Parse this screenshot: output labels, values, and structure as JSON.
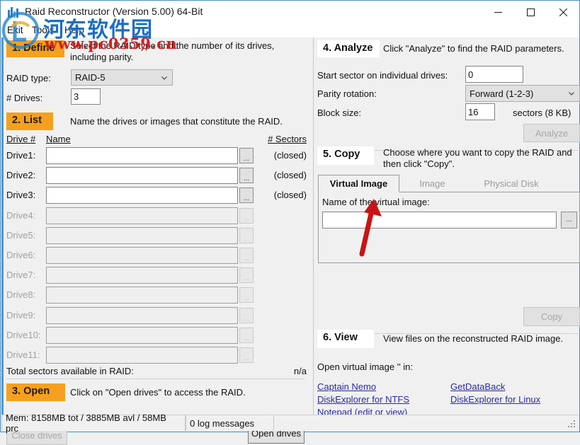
{
  "window": {
    "title": "Raid Reconstructor (Version 5.00) 64-Bit",
    "icon": "raid-bars-icon",
    "minimize": "minimize-icon",
    "maximize": "maximize-icon",
    "close": "close-icon"
  },
  "menu": {
    "items": [
      "Exit",
      "Tools",
      "Help"
    ]
  },
  "watermark": {
    "cn": "河东软件园",
    "url": "www.pc0359.cn"
  },
  "define": {
    "badge": "1. Define",
    "description": "Select the RAID type and the number of its drives, including parity.",
    "raid_type_label": "RAID type:",
    "raid_type_value": "RAID-5",
    "raid_type_options": [
      "RAID-5"
    ],
    "drives_label": "# Drives:",
    "drives_value": "3"
  },
  "list": {
    "badge": "2. List",
    "description": "Name the drives or images that constitute the RAID.",
    "col_drive": "Drive #",
    "col_name": "Name",
    "col_sectors": "# Sectors",
    "browse_button": "...",
    "rows": [
      {
        "label": "Drive1:",
        "value": "",
        "sectors": "(closed)",
        "enabled": true
      },
      {
        "label": "Drive2:",
        "value": "",
        "sectors": "(closed)",
        "enabled": true
      },
      {
        "label": "Drive3:",
        "value": "",
        "sectors": "(closed)",
        "enabled": true
      },
      {
        "label": "Drive4:",
        "value": "",
        "sectors": "",
        "enabled": false
      },
      {
        "label": "Drive5:",
        "value": "",
        "sectors": "",
        "enabled": false
      },
      {
        "label": "Drive6:",
        "value": "",
        "sectors": "",
        "enabled": false
      },
      {
        "label": "Drive7:",
        "value": "",
        "sectors": "",
        "enabled": false
      },
      {
        "label": "Drive8:",
        "value": "",
        "sectors": "",
        "enabled": false
      },
      {
        "label": "Drive9:",
        "value": "",
        "sectors": "",
        "enabled": false
      },
      {
        "label": "Drive10:",
        "value": "",
        "sectors": "",
        "enabled": false
      },
      {
        "label": "Drive11:",
        "value": "",
        "sectors": "",
        "enabled": false
      }
    ],
    "total_label": "Total sectors available in RAID:",
    "total_value": "n/a"
  },
  "open": {
    "badge": "3. Open",
    "description": "Click on \"Open drives\" to access the RAID.",
    "close_button": "Close drives",
    "open_button": "Open drives"
  },
  "analyze": {
    "badge": "4. Analyze",
    "description": "Click \"Analyze\" to find the RAID parameters.",
    "start_sector_label": "Start sector on individual drives:",
    "start_sector_value": "0",
    "parity_label": "Parity rotation:",
    "parity_value": "Forward (1-2-3)",
    "parity_options": [
      "Forward (1-2-3)"
    ],
    "block_size_label": "Block size:",
    "block_size_value": "16",
    "block_size_unit": "sectors (8 KB)",
    "analyze_button": "Analyze"
  },
  "copy": {
    "badge": "5. Copy",
    "description": "Choose where you want to copy the RAID and then click \"Copy\".",
    "tabs": [
      {
        "label": "Virtual Image",
        "active": true
      },
      {
        "label": "Image",
        "active": false
      },
      {
        "label": "Physical Disk",
        "active": false
      }
    ],
    "virtual_image_label": "Name of the virtual image:",
    "virtual_image_value": "",
    "browse_button": "...",
    "copy_button": "Copy"
  },
  "view": {
    "badge": "6. View",
    "description": "View files on the reconstructed RAID image.",
    "open_in_label": "Open virtual image '' in:",
    "links": [
      "Captain Nemo",
      "GetDataBack",
      "DiskExplorer for NTFS",
      "DiskExplorer for Linux",
      "Notepad (edit or view)"
    ]
  },
  "statusbar": {
    "memory": "Mem: 8158MB tot / 3885MB avl / 58MB prc",
    "log": "0 log messages"
  },
  "colors": {
    "accent_orange": "#f5a01e",
    "link": "#2a2aa5",
    "border_blue": "#4a9ad4",
    "arrow_red": "#c81414"
  }
}
